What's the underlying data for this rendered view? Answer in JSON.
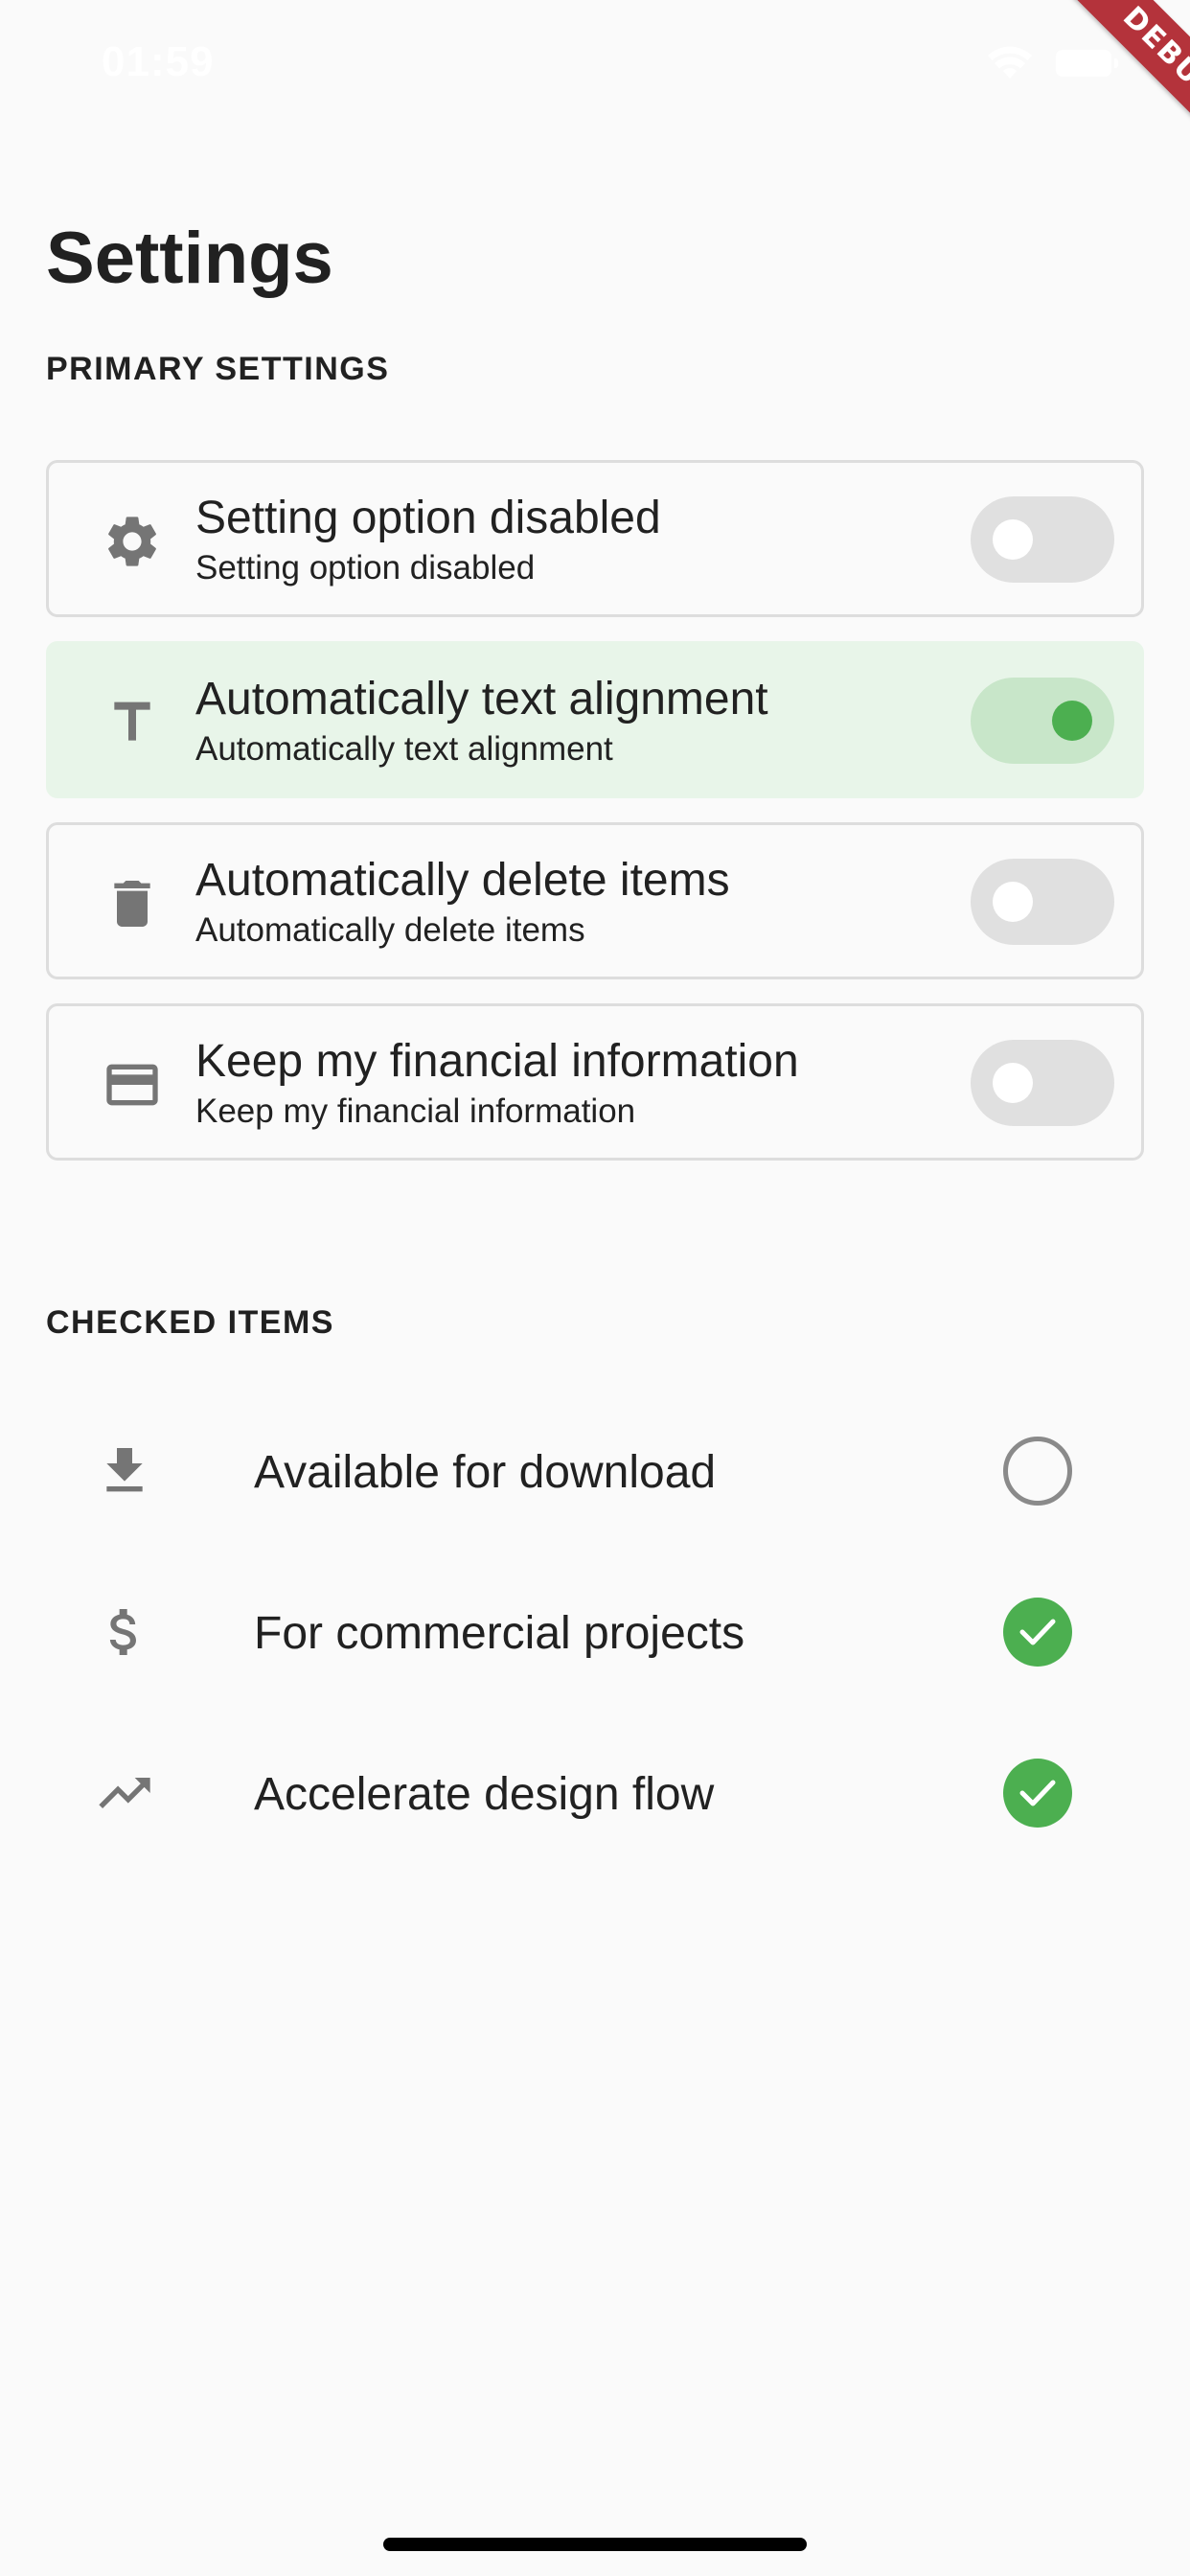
{
  "status_bar": {
    "time": "01:59",
    "wifi_icon": "wifi-icon",
    "battery_icon": "battery-icon"
  },
  "debug_banner": "DEBUG",
  "page_title": "Settings",
  "primary_section": {
    "title": "PRIMARY SETTINGS",
    "settings": [
      {
        "icon": "gear-icon",
        "title": "Setting option disabled",
        "subtitle": "Setting option disabled",
        "enabled": false
      },
      {
        "icon": "text-format-icon",
        "title": "Automatically text alignment",
        "subtitle": "Automatically text alignment",
        "enabled": true
      },
      {
        "icon": "trash-icon",
        "title": "Automatically delete items",
        "subtitle": "Automatically delete items",
        "enabled": false
      },
      {
        "icon": "credit-card-icon",
        "title": "Keep my financial information",
        "subtitle": "Keep my financial information",
        "enabled": false
      }
    ]
  },
  "checked_section": {
    "title": "CHECKED ITEMS",
    "items": [
      {
        "icon": "download-icon",
        "label": "Available for download",
        "checked": false
      },
      {
        "icon": "dollar-icon",
        "label": "For commercial projects",
        "checked": true
      },
      {
        "icon": "trending-up-icon",
        "label": "Accelerate design flow",
        "checked": true
      }
    ]
  },
  "colors": {
    "background": "#fafafa",
    "accent_green": "#4caf50",
    "active_card_bg": "#e8f5e9",
    "toggle_off": "#e0e0e0",
    "icon_gray": "#757575",
    "debug_red": "#b4333b"
  }
}
